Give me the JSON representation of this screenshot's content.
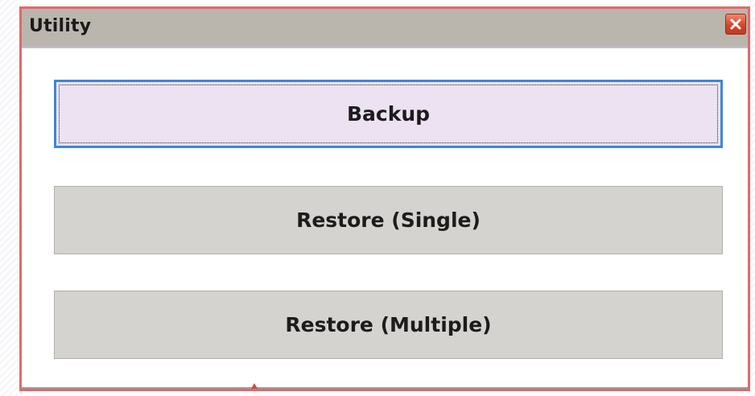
{
  "window": {
    "title": "Utility",
    "close_icon": "close-icon",
    "accent_color": "#e06a6a"
  },
  "buttons": {
    "backup": "Backup",
    "restore_single": "Restore (Single)",
    "restore_multiple": "Restore (Multiple)"
  },
  "colors": {
    "titlebar": "#bbb6ad",
    "focused_button_bg": "#ede2f1",
    "focus_border": "#3f86d8",
    "button_bg": "#d5d3d0",
    "close_button": "#d2482a"
  }
}
